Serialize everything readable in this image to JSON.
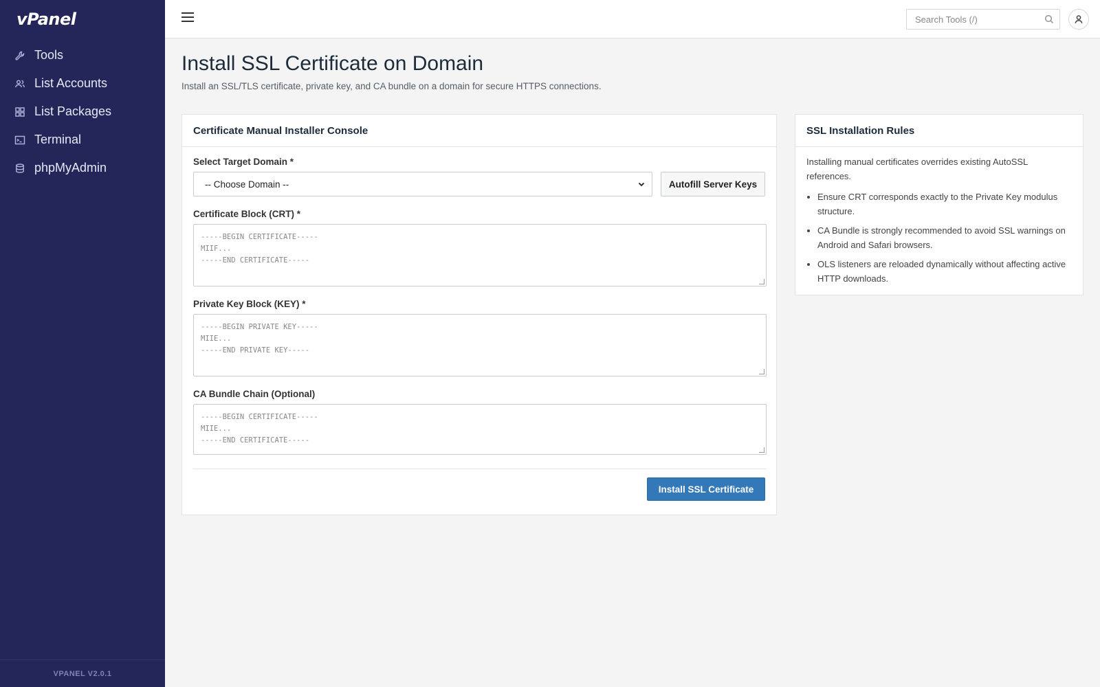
{
  "app": {
    "logo": "vPanel",
    "version": "VPANEL V2.0.1"
  },
  "sidebar": {
    "items": [
      {
        "label": "Tools",
        "icon": "wrench-icon"
      },
      {
        "label": "List Accounts",
        "icon": "users-icon"
      },
      {
        "label": "List Packages",
        "icon": "grid-icon"
      },
      {
        "label": "Terminal",
        "icon": "terminal-icon"
      },
      {
        "label": "phpMyAdmin",
        "icon": "database-icon"
      }
    ]
  },
  "topbar": {
    "search_placeholder": "Search Tools (/)"
  },
  "page": {
    "title": "Install SSL Certificate on Domain",
    "description": "Install an SSL/TLS certificate, private key, and CA bundle on a domain for secure HTTPS connections."
  },
  "installer": {
    "title": "Certificate Manual Installer Console",
    "domain_label": "Select Target Domain *",
    "domain_selected": "-- Choose Domain --",
    "autofill_label": "Autofill Server Keys",
    "crt_label": "Certificate Block (CRT) *",
    "crt_placeholder": "-----BEGIN CERTIFICATE-----\nMIIF...\n-----END CERTIFICATE-----",
    "key_label": "Private Key Block (KEY) *",
    "key_placeholder": "-----BEGIN PRIVATE KEY-----\nMIIE...\n-----END PRIVATE KEY-----",
    "ca_label": "CA Bundle Chain (Optional)",
    "ca_placeholder": "-----BEGIN CERTIFICATE-----\nMIIE...\n-----END CERTIFICATE-----",
    "submit_label": "Install SSL Certificate"
  },
  "rules": {
    "title": "SSL Installation Rules",
    "intro": "Installing manual certificates overrides existing AutoSSL references.",
    "items": [
      "Ensure CRT corresponds exactly to the Private Key modulus structure.",
      "CA Bundle is strongly recommended to avoid SSL warnings on Android and Safari browsers.",
      "OLS listeners are reloaded dynamically without affecting active HTTP downloads."
    ]
  },
  "colors": {
    "sidebar_bg": "#24265a",
    "primary": "#3378b8",
    "page_bg": "#f4f4f4"
  }
}
